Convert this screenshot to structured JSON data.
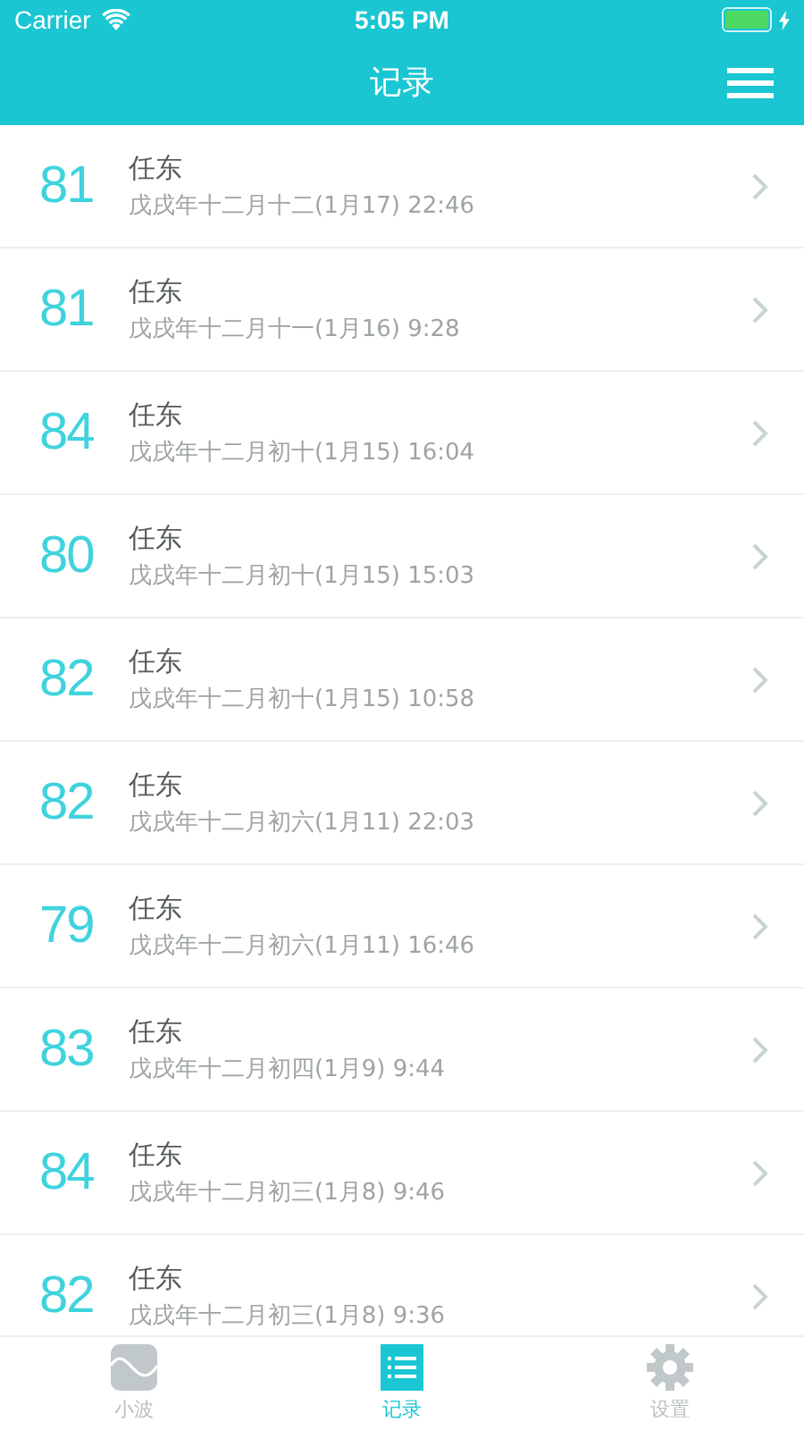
{
  "status_bar": {
    "carrier": "Carrier",
    "time": "5:05 PM",
    "charging": true
  },
  "nav": {
    "title": "记录"
  },
  "records": [
    {
      "score": "81",
      "name": "任东",
      "date": "戊戌年十二月十二(1月17) 22:46"
    },
    {
      "score": "81",
      "name": "任东",
      "date": "戊戌年十二月十一(1月16) 9:28"
    },
    {
      "score": "84",
      "name": "任东",
      "date": "戊戌年十二月初十(1月15) 16:04"
    },
    {
      "score": "80",
      "name": "任东",
      "date": "戊戌年十二月初十(1月15) 15:03"
    },
    {
      "score": "82",
      "name": "任东",
      "date": "戊戌年十二月初十(1月15) 10:58"
    },
    {
      "score": "82",
      "name": "任东",
      "date": "戊戌年十二月初六(1月11) 22:03"
    },
    {
      "score": "79",
      "name": "任东",
      "date": "戊戌年十二月初六(1月11) 16:46"
    },
    {
      "score": "83",
      "name": "任东",
      "date": "戊戌年十二月初四(1月9) 9:44"
    },
    {
      "score": "84",
      "name": "任东",
      "date": "戊戌年十二月初三(1月8) 9:46"
    },
    {
      "score": "82",
      "name": "任东",
      "date": "戊戌年十二月初三(1月8) 9:36"
    }
  ],
  "tabs": [
    {
      "label": "小波",
      "kind": "wave",
      "selected": false
    },
    {
      "label": "记录",
      "kind": "list",
      "selected": true
    },
    {
      "label": "设置",
      "kind": "gear",
      "selected": false
    }
  ]
}
